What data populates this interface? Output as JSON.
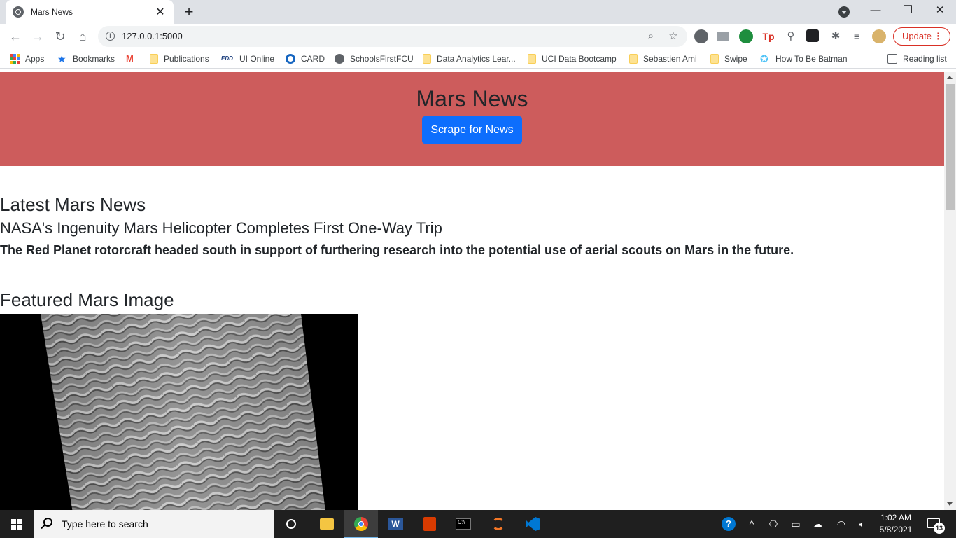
{
  "browser": {
    "tab_title": "Mars News",
    "new_tab": "+",
    "url": "127.0.0.1:5000",
    "update_label": "Update",
    "bookmarks": [
      {
        "label": "Apps"
      },
      {
        "label": "Bookmarks"
      },
      {
        "label": "Publications"
      },
      {
        "label": "UI Online"
      },
      {
        "label": "CARD"
      },
      {
        "label": "SchoolsFirstFCU"
      },
      {
        "label": "Data Analytics Lear..."
      },
      {
        "label": "UCI Data Bootcamp"
      },
      {
        "label": "Sebastien Ami"
      },
      {
        "label": "Swipe"
      },
      {
        "label": "How To Be Batman"
      }
    ],
    "reading_list": "Reading list"
  },
  "page": {
    "heading": "Mars News",
    "scrape_button": "Scrape for News",
    "latest_heading": "Latest Mars News",
    "news_title": "NASA's Ingenuity Mars Helicopter Completes First One-Way Trip",
    "news_paragraph": "The Red Planet rotorcraft headed south in support of furthering research into the potential use of aerial scouts on Mars in the future.",
    "featured_heading": "Featured Mars Image"
  },
  "taskbar": {
    "search_placeholder": "Type here to search",
    "time": "1:02 AM",
    "date": "5/8/2021",
    "notification_count": "13"
  },
  "colors": {
    "jumbotron": "#cd5c5c",
    "primary_button": "#0d6efd"
  }
}
